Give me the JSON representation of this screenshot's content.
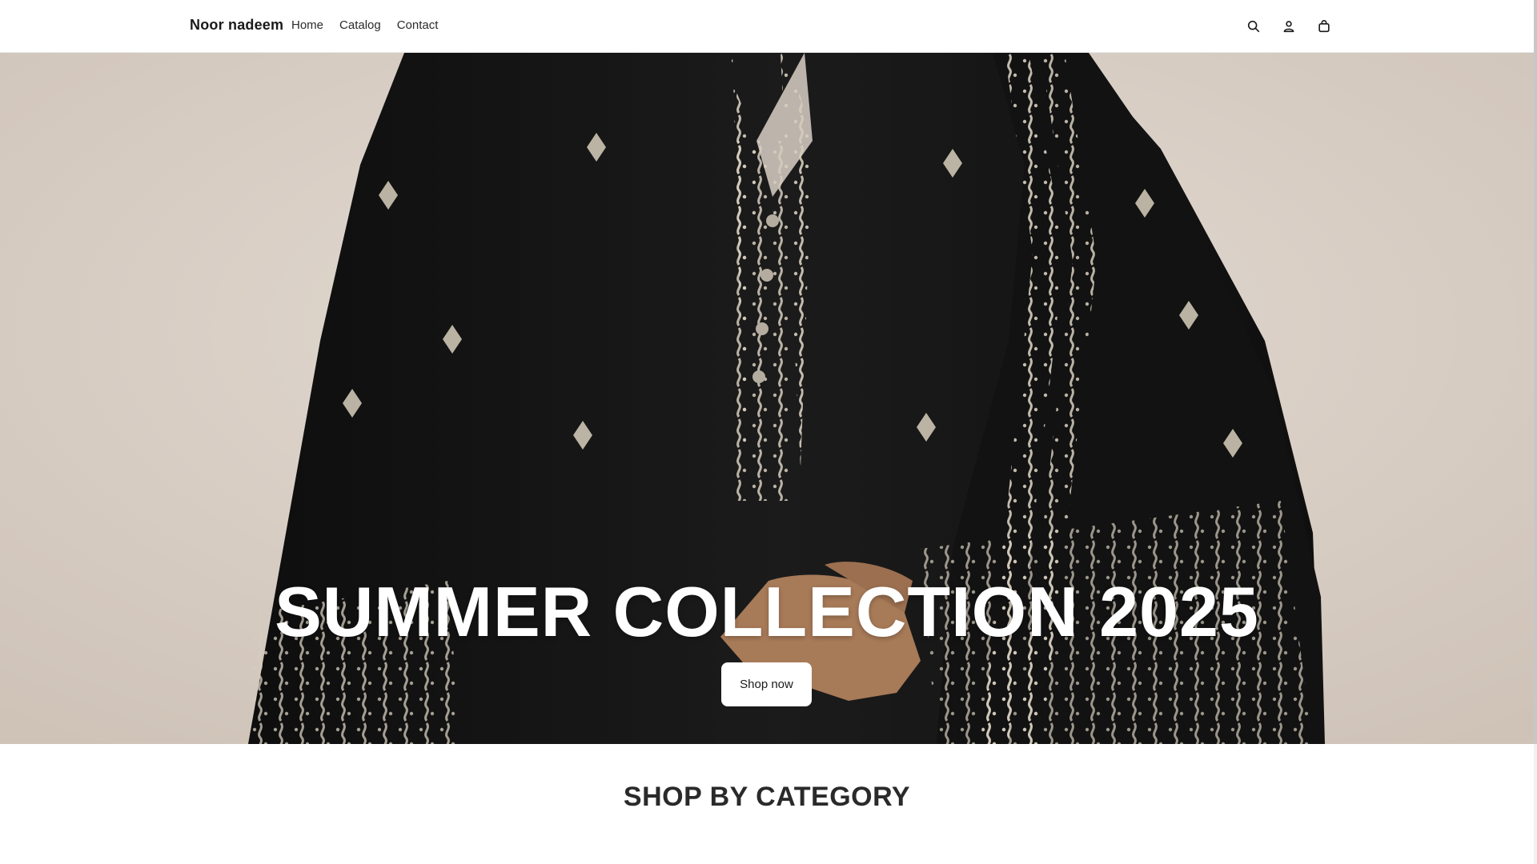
{
  "header": {
    "brand": "Noor nadeem",
    "nav": [
      {
        "label": "Home"
      },
      {
        "label": "Catalog"
      },
      {
        "label": "Contact"
      }
    ],
    "icons": [
      "search-icon",
      "account-icon",
      "cart-icon"
    ]
  },
  "hero": {
    "title": "SUMMER COLLECTION 2025",
    "button_label": "Shop now"
  },
  "section": {
    "title": "SHOP BY CATEGORY"
  },
  "colors": {
    "hero_background": "#d9cfc6",
    "garment": "#141414",
    "embroidery": "#cfc6b5",
    "text_dark": "#1a1a1a"
  }
}
